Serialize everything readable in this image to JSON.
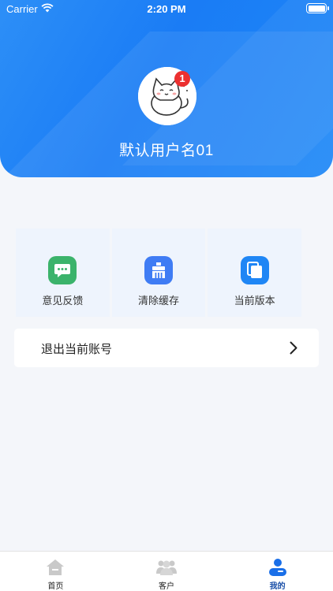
{
  "status_bar": {
    "carrier": "Carrier",
    "time": "2:20 PM"
  },
  "profile": {
    "username": "默认用户名01",
    "badge_count": "1"
  },
  "grid": [
    {
      "label": "意见反馈",
      "icon": "feedback-icon",
      "color": "#3bb36b"
    },
    {
      "label": "清除缓存",
      "icon": "clear-cache-icon",
      "color": "#3f7cf4"
    },
    {
      "label": "当前版本",
      "icon": "version-icon",
      "color": "#1f86f5"
    }
  ],
  "logout": {
    "label": "退出当前账号"
  },
  "tabbar": [
    {
      "label": "首页",
      "icon": "home-icon",
      "active": false
    },
    {
      "label": "客户",
      "icon": "customers-icon",
      "active": false
    },
    {
      "label": "我的",
      "icon": "profile-icon",
      "active": true
    }
  ],
  "colors": {
    "primary": "#1a7cf5",
    "background": "#f4f6fa",
    "active_tab": "#1a4fa8"
  }
}
